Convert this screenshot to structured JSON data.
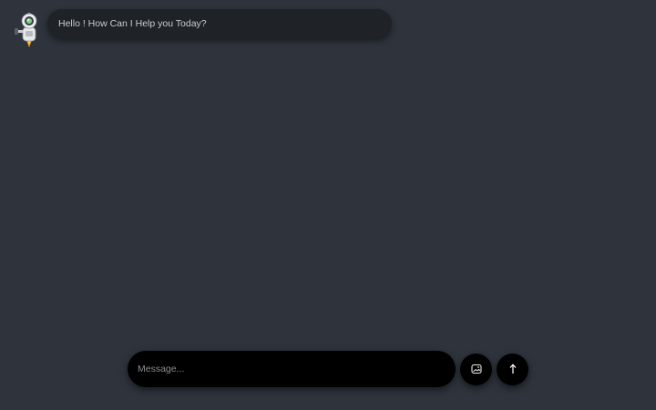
{
  "chat": {
    "messages": [
      {
        "sender": "bot",
        "avatar_icon": "robot-icon",
        "text": "Hello ! How Can I Help you Today?"
      }
    ]
  },
  "composer": {
    "placeholder": "Message...",
    "value": "",
    "attach_icon": "image-upload-icon",
    "send_icon": "arrow-up-icon"
  },
  "colors": {
    "background": "#2e333c",
    "bubble": "#1f2227",
    "input": "#000000",
    "text": "#c9cdd3"
  }
}
